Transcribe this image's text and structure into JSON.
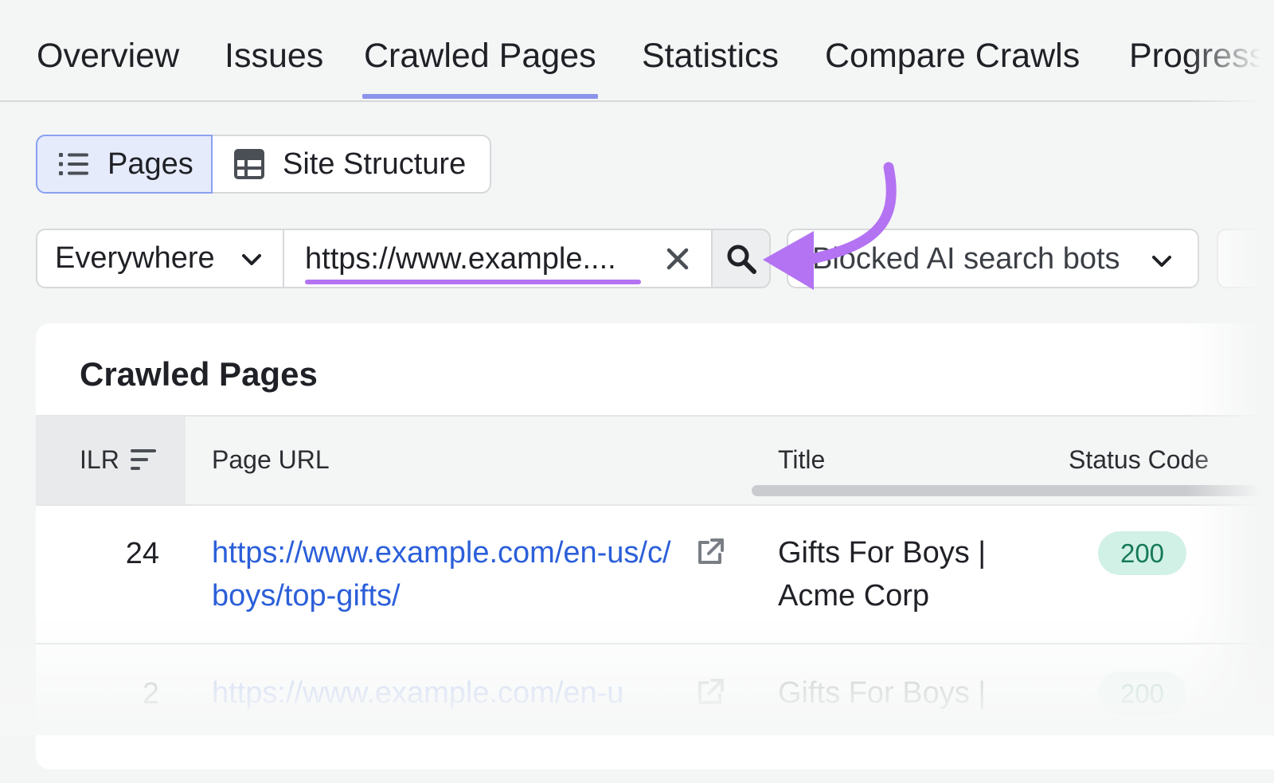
{
  "tabs": [
    {
      "label": "Overview",
      "active": false
    },
    {
      "label": "Issues",
      "active": false
    },
    {
      "label": "Crawled Pages",
      "active": true
    },
    {
      "label": "Statistics",
      "active": false
    },
    {
      "label": "Compare Crawls",
      "active": false
    },
    {
      "label": "Progress",
      "active": false
    }
  ],
  "view_toggle": {
    "pages_label": "Pages",
    "structure_label": "Site Structure",
    "selected": "Pages"
  },
  "filters": {
    "scope_value": "Everywhere",
    "url_value": "https://www.example....",
    "bots_value": "Blocked AI search bots"
  },
  "table": {
    "title": "Crawled Pages",
    "columns": [
      "ILR",
      "Page URL",
      "Title",
      "Status Code"
    ],
    "rows": [
      {
        "ilr": "24",
        "url": "https://www.example.com/en-us/c/boys/top-gifts/",
        "title": "Gifts For Boys | Acme Corp",
        "status": "200"
      },
      {
        "ilr": "2",
        "url": "https://www.example.com/en-u",
        "title": "Gifts For Boys |",
        "status": "200"
      }
    ]
  },
  "colors": {
    "accent_tab_underline": "#8b93ea",
    "annotation_purple": "#b373f2",
    "link_blue": "#2b5fd9",
    "status_badge_bg": "#d2f1e6",
    "status_badge_text": "#167a5a"
  },
  "icons": [
    "list-icon",
    "table-grid-icon",
    "chevron-down-icon",
    "close-icon",
    "search-icon",
    "sort-icon",
    "external-link-icon",
    "curved-arrow-annotation"
  ]
}
